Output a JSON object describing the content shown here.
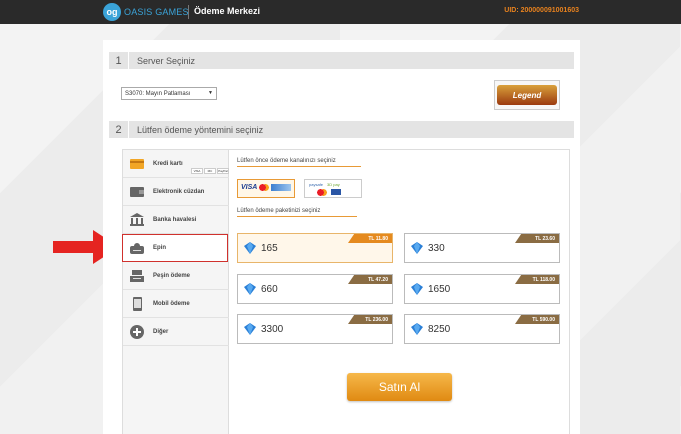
{
  "topbar": {
    "logo_mark": "og",
    "logo_text": "OASIS GAMES",
    "title": "Ödeme Merkezi",
    "uid": "UID: 200000091001603"
  },
  "step1": {
    "num": "1",
    "label": "Server Seçiniz"
  },
  "server_select": {
    "value": "S3070: Mayın Patlaması"
  },
  "game_logo": {
    "text": "Legend"
  },
  "step2": {
    "num": "2",
    "label": "Lütfen ödeme yöntemini seçiniz"
  },
  "sidebar": {
    "items": [
      {
        "label": "Kredi kartı"
      },
      {
        "label": "Elektronik cüzdan"
      },
      {
        "label": "Banka havalesi"
      },
      {
        "label": "Epin"
      },
      {
        "label": "Peşin ödeme"
      },
      {
        "label": "Mobil ödeme"
      },
      {
        "label": "Diğer"
      }
    ],
    "card_logos": [
      "VISA",
      "MC",
      "PayPal"
    ]
  },
  "channels": {
    "label": "Lütfen önce ödeme kanalınızı seçiniz",
    "option1": "VISA",
    "option2_line1": "paysafe",
    "option2_line2": "3D pay"
  },
  "packages": {
    "label": "Lütfen ödeme paketinizi seçiniz",
    "items": [
      {
        "amount": "165",
        "price": "TL 11.80"
      },
      {
        "amount": "330",
        "price": "TL 23.60"
      },
      {
        "amount": "660",
        "price": "TL 47.20"
      },
      {
        "amount": "1650",
        "price": "TL 118.00"
      },
      {
        "amount": "3300",
        "price": "TL 236.00"
      },
      {
        "amount": "8250",
        "price": "TL 590.00"
      }
    ]
  },
  "buy_button": {
    "label": "Satın Al"
  },
  "colors": {
    "accent": "#e08a12",
    "brand": "#3aa3d8",
    "highlight": "#d0312d"
  }
}
